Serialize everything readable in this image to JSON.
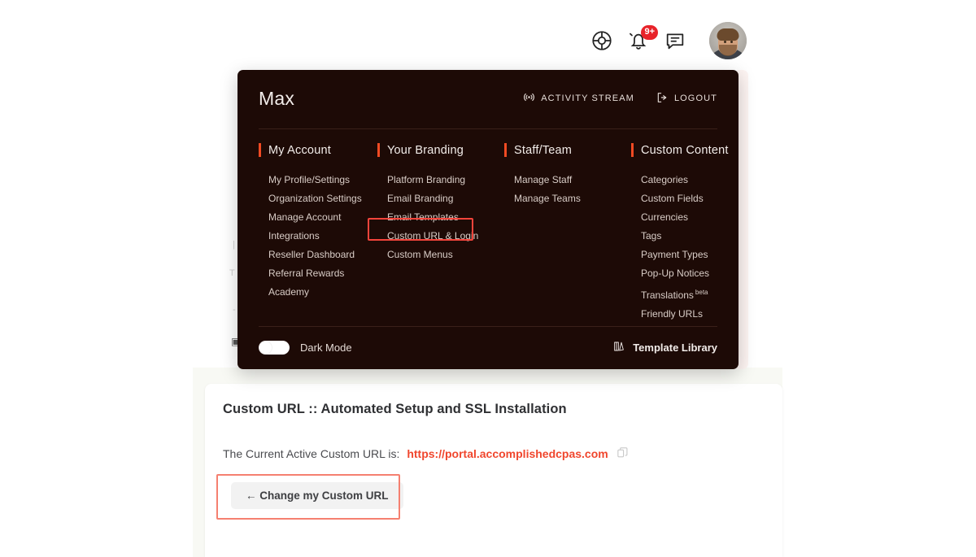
{
  "topbar": {
    "help_icon": "life-ring-icon",
    "notifications_icon": "bell-icon",
    "notifications_badge": "9+",
    "messages_icon": "chat-bubble-icon",
    "avatar": "user-avatar"
  },
  "background_fragments": {
    "f1": "|",
    "f2": "T",
    "f3": "-",
    "f4": "▣"
  },
  "panel": {
    "user_name": "Max",
    "activity_stream_label": "ACTIVITY STREAM",
    "activity_stream_icon": "broadcast-icon",
    "logout_label": "LOGOUT",
    "logout_icon": "logout-icon",
    "accent_color": "#f04a23",
    "background_color": "#1d0a06",
    "columns": [
      {
        "title": "My Account",
        "items": [
          "My Profile/Settings",
          "Organization Settings",
          "Manage Account",
          "Integrations",
          "Reseller Dashboard",
          "Referral Rewards",
          "Academy"
        ]
      },
      {
        "title": "Your Branding",
        "items": [
          "Platform Branding",
          "Email Branding",
          "Email Templates",
          "Custom URL & Login",
          "Custom Menus"
        ],
        "highlighted_item": "Custom URL & Login"
      },
      {
        "title": "Staff/Team",
        "items": [
          "Manage Staff",
          "Manage Teams"
        ]
      },
      {
        "title": "Custom Content",
        "items": [
          "Categories",
          "Custom Fields",
          "Currencies",
          "Tags",
          "Payment Types",
          "Pop-Up Notices",
          "Translations",
          "Friendly URLs"
        ],
        "translations_badge": "beta"
      }
    ],
    "footer": {
      "dark_mode_label": "Dark Mode",
      "dark_mode_on": false,
      "template_library_label": "Template Library",
      "template_library_icon": "book-icon"
    }
  },
  "content": {
    "title": "Custom URL :: Automated Setup and SSL Installation",
    "url_prefix": "The Current Active Custom URL is:",
    "url_value": "https://portal.accomplishedcpas.com",
    "copy_icon": "copy-icon",
    "change_button_label": "← Change my Custom URL",
    "url_color": "#f0462d"
  },
  "annotations": {
    "menu_highlight_color": "#f4443b",
    "button_highlight_color": "#f58070"
  }
}
